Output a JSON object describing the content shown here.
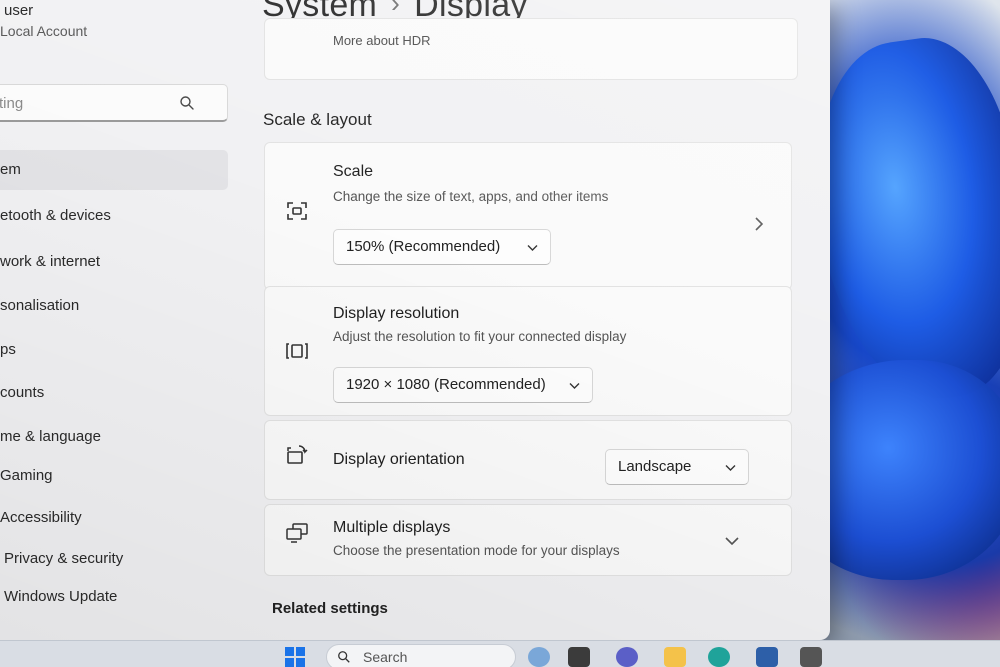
{
  "user": {
    "name": "user",
    "account_type": "Local Account"
  },
  "search": {
    "placeholder": "ting",
    "icon": "search-icon"
  },
  "nav": {
    "items": [
      {
        "label": "em",
        "selected": true
      },
      {
        "label": "etooth & devices"
      },
      {
        "label": "work & internet"
      },
      {
        "label": "sonalisation"
      },
      {
        "label": "ps"
      },
      {
        "label": "counts"
      },
      {
        "label": "me & language"
      },
      {
        "label": "Gaming"
      },
      {
        "label": "Accessibility"
      },
      {
        "label": "Privacy & security"
      },
      {
        "label": "Windows Update"
      }
    ]
  },
  "breadcrumb": {
    "parent": "System",
    "separator": "›",
    "current": "Display"
  },
  "hdr_card": {
    "link": "More about HDR"
  },
  "section": {
    "title": "Scale & layout"
  },
  "scale": {
    "title": "Scale",
    "description": "Change the size of text, apps, and other items",
    "value": "150% (Recommended)"
  },
  "resolution": {
    "title": "Display resolution",
    "description": "Adjust the resolution to fit your connected display",
    "value": "1920 × 1080 (Recommended)"
  },
  "orientation": {
    "title": "Display orientation",
    "value": "Landscape"
  },
  "multiple": {
    "title": "Multiple displays",
    "description": "Choose the presentation mode for your displays"
  },
  "related": {
    "title": "Related settings"
  },
  "taskbar": {
    "search_label": "Search"
  },
  "colors": {
    "accent": "#0067c0",
    "window_bg": "#f1f1f3",
    "card_bg": "#fafafa"
  }
}
